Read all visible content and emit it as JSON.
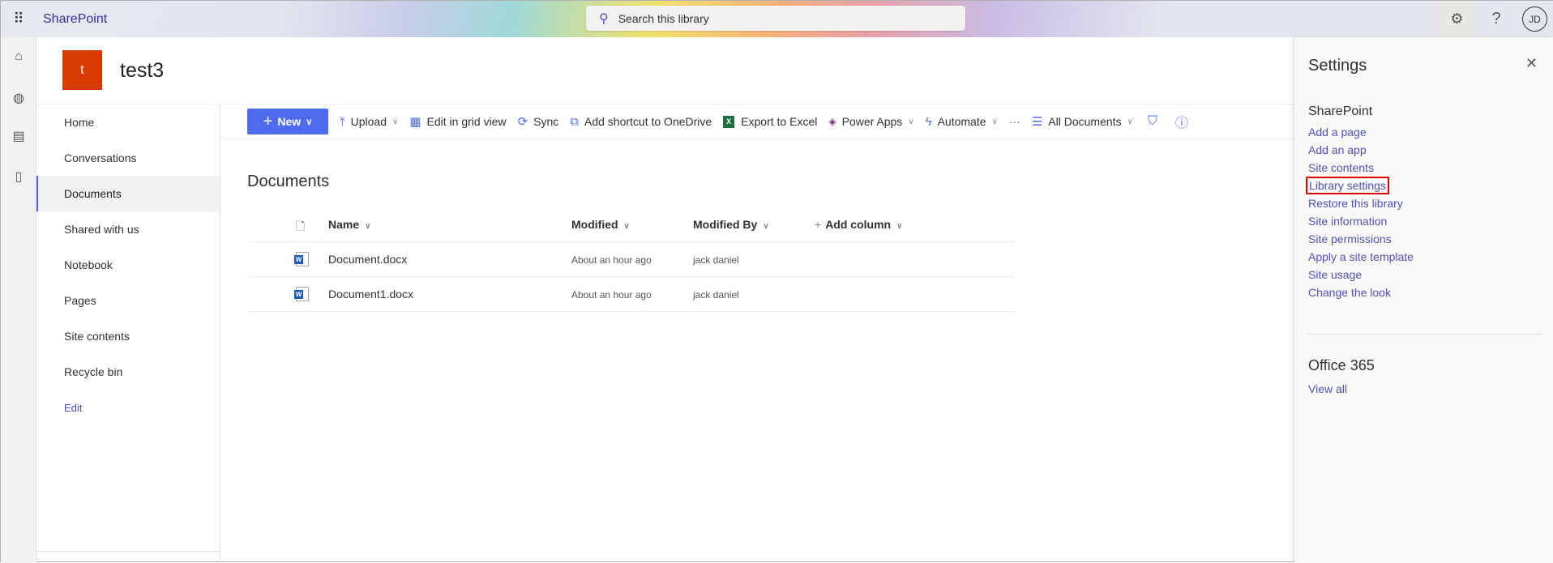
{
  "topbar": {
    "brand": "SharePoint",
    "search_placeholder": "Search this library",
    "avatar": "JD",
    "help": "?"
  },
  "site": {
    "logo_letter": "t",
    "title": "test3"
  },
  "nav": [
    "Home",
    "Conversations",
    "Documents",
    "Shared with us",
    "Notebook",
    "Pages",
    "Site contents",
    "Recycle bin",
    "Edit"
  ],
  "nav_active": "Documents",
  "commands": {
    "new": "New",
    "upload": "Upload",
    "grid": "Edit in grid view",
    "sync": "Sync",
    "shortcut": "Add shortcut to OneDrive",
    "excel": "Export to Excel",
    "powerapps": "Power Apps",
    "automate": "Automate",
    "more": "···",
    "view": "All Documents"
  },
  "library": {
    "title": "Documents",
    "columns": {
      "name": "Name",
      "modified": "Modified",
      "modified_by": "Modified By",
      "add": "Add column"
    },
    "rows": [
      {
        "name": "Document.docx",
        "modified": "About an hour ago",
        "by": "jack daniel"
      },
      {
        "name": "Document1.docx",
        "modified": "About an hour ago",
        "by": "jack daniel"
      }
    ]
  },
  "settings": {
    "title": "Settings",
    "section": "SharePoint",
    "links": [
      "Add a page",
      "Add an app",
      "Site contents",
      "Library settings",
      "Restore this library",
      "Site information",
      "Site permissions",
      "Apply a site template",
      "Site usage",
      "Change the look"
    ],
    "highlighted": "Library settings",
    "office_title": "Office 365",
    "view_all": "View all"
  }
}
